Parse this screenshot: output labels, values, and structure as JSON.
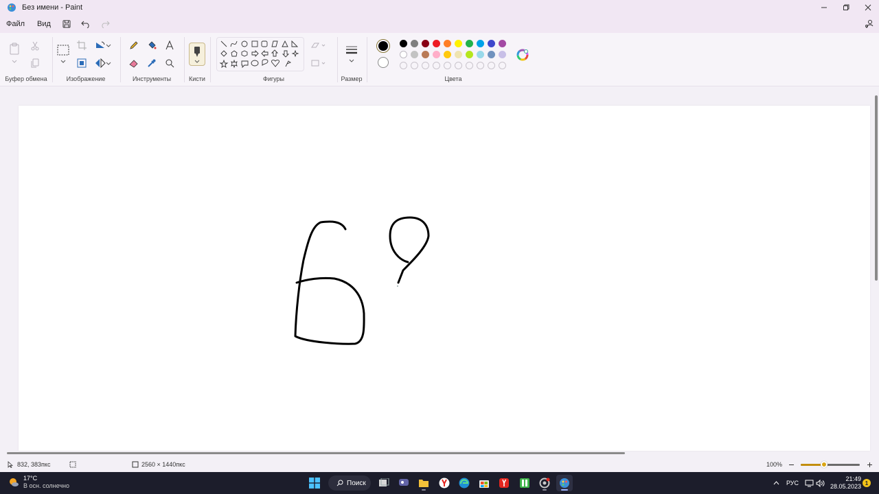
{
  "window": {
    "title": "Без имени - Paint",
    "app_icon": "paint-palette-icon"
  },
  "menu": {
    "file": "Файл",
    "view": "Вид"
  },
  "ribbon": {
    "clipboard": {
      "label": "Буфер обмена"
    },
    "image": {
      "label": "Изображение"
    },
    "tools": {
      "label": "Инструменты"
    },
    "brushes": {
      "label": "Кисти"
    },
    "shapes": {
      "label": "Фигуры"
    },
    "size": {
      "label": "Размер"
    },
    "colors": {
      "label": "Цвета",
      "primary": "#000000",
      "secondary": "#ffffff",
      "row1": [
        "#000000",
        "#7f7f7f",
        "#880015",
        "#ed1c24",
        "#ff7f27",
        "#fff200",
        "#22b14c",
        "#00a2e8",
        "#3f48cc",
        "#a349a4"
      ],
      "row2": [
        "#ffffff",
        "#c3c3c3",
        "#b97a57",
        "#ffaec9",
        "#ffc90e",
        "#efe4b0",
        "#b5e61d",
        "#99d9ea",
        "#7092be",
        "#c8bfe7"
      ]
    }
  },
  "status": {
    "cursor_pos": "832, 383пкс",
    "canvas_size": "2560 × 1440пкс",
    "zoom": "100%",
    "zoom_level": 0.4
  },
  "taskbar": {
    "weather_temp": "17°C",
    "weather_desc": "В осн. солнечно",
    "search_label": "Поиск",
    "lang": "РУС",
    "time": "21:49",
    "date": "28.05.2023",
    "notifications": "1"
  }
}
